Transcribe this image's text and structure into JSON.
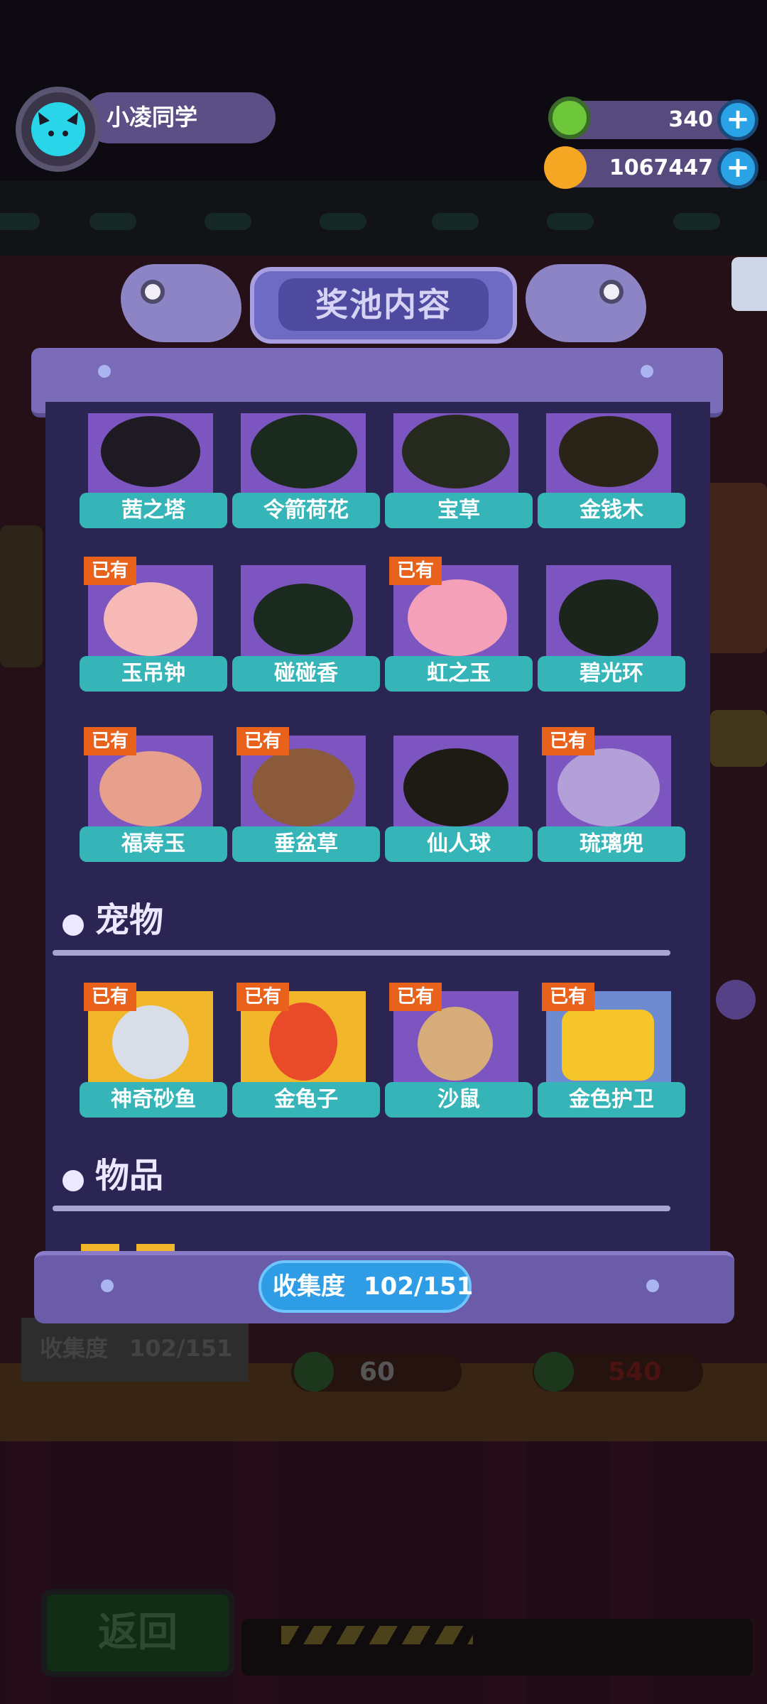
{
  "hud": {
    "player_name": "小凌同学",
    "currency_green": "340",
    "currency_gold": "1067447",
    "plus_symbol": "+"
  },
  "panel": {
    "title": "奖池内容",
    "plants_partial": [
      {
        "name": "茜之塔",
        "owned": false
      },
      {
        "name": "令箭荷花",
        "owned": false
      },
      {
        "name": "宝草",
        "owned": false
      },
      {
        "name": "金钱木",
        "owned": false
      }
    ],
    "plants_row2": [
      {
        "name": "玉吊钟",
        "owned": true
      },
      {
        "name": "碰碰香",
        "owned": false
      },
      {
        "name": "虹之玉",
        "owned": true
      },
      {
        "name": "碧光环",
        "owned": false
      }
    ],
    "plants_row3": [
      {
        "name": "福寿玉",
        "owned": true
      },
      {
        "name": "垂盆草",
        "owned": true
      },
      {
        "name": "仙人球",
        "owned": false
      },
      {
        "name": "琉璃兜",
        "owned": true
      }
    ],
    "owned_tag": "已有",
    "pets_section": "宠物",
    "pets": [
      {
        "name": "神奇砂鱼",
        "owned": true
      },
      {
        "name": "金龟子",
        "owned": true
      },
      {
        "name": "沙鼠",
        "owned": true
      },
      {
        "name": "金色护卫",
        "owned": true
      }
    ],
    "items_section": "物品",
    "collection_label": "收集度",
    "collection_value": "102/151"
  },
  "background": {
    "collection_label": "收集度",
    "collection_value": "102/151",
    "price_left": "60",
    "price_right": "540",
    "back_button": "返回"
  },
  "colors": {
    "panel_bg": "#2a2552",
    "card_label": "#36b5b8",
    "owned_tag": "#e8621c",
    "collect_pill": "#2e9de6"
  }
}
